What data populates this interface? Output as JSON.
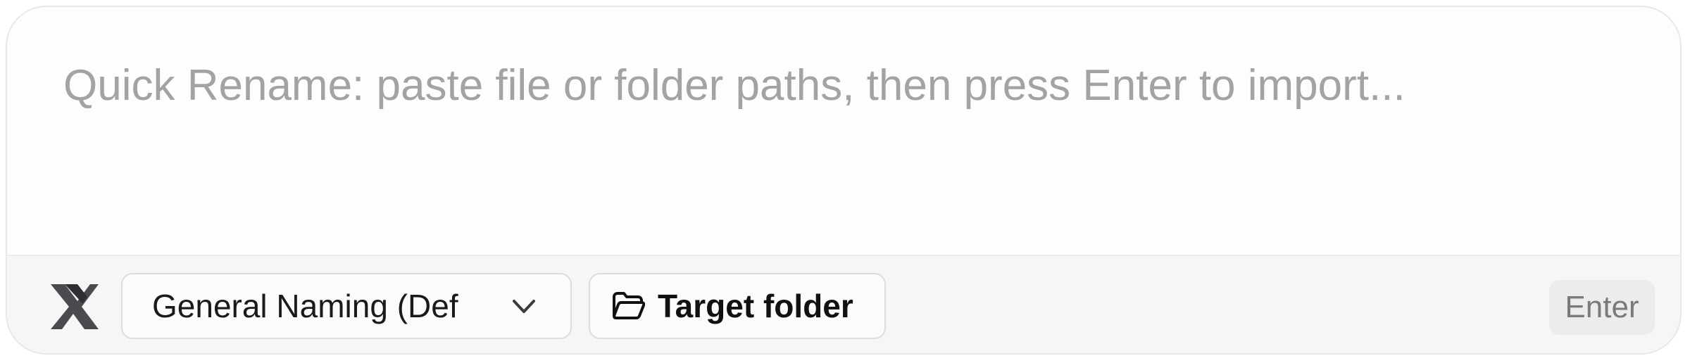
{
  "prompt": {
    "placeholder": "Quick Rename: paste file or folder paths, then press Enter to import...",
    "value": ""
  },
  "footer": {
    "logo_icon": "x-logo-icon",
    "naming_select": {
      "selected_label": "General Naming (Def",
      "icon": "chevron-down-icon"
    },
    "target_folder": {
      "label": "Target folder",
      "icon": "folder-open-icon"
    },
    "enter_key": {
      "label": "Enter"
    }
  },
  "colors": {
    "placeholder_text": "#a3a3a3",
    "footer_background": "#f6f6f7",
    "border": "#dcdcdf",
    "enter_badge": "#ececec"
  }
}
